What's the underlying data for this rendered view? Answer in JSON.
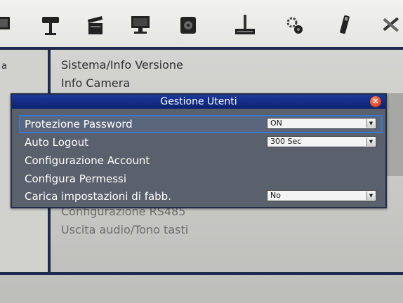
{
  "toolbar": {
    "icons": [
      "monitor-icon",
      "camera-icon",
      "clapperboard-icon",
      "computer-icon",
      "hdd-icon",
      "network-icon",
      "gear-icon",
      "usb-icon",
      "tools-icon"
    ]
  },
  "left_panel": {
    "label": "a"
  },
  "menu": {
    "items": [
      "Sistema/Info Versione",
      "Info Camera",
      "Configurazione RS485",
      "Uscita audio/Tono tasti"
    ]
  },
  "dialog": {
    "title": "Gestione Utenti",
    "close_symbol": "✕",
    "rows": [
      {
        "label": "Protezione Password",
        "value": "ON"
      },
      {
        "label": "Auto Logout",
        "value": "300 Sec"
      },
      {
        "label": "Configurazione Account"
      },
      {
        "label": "Configura Permessi"
      },
      {
        "label": "Carica impostazioni di fabb.",
        "value": "No"
      }
    ]
  },
  "colors": {
    "dialog_bg": "#5a616c",
    "title_bar": "#0b2070",
    "selection_outline": "#3a76c9",
    "frame_lines": "#1e2a4f"
  }
}
